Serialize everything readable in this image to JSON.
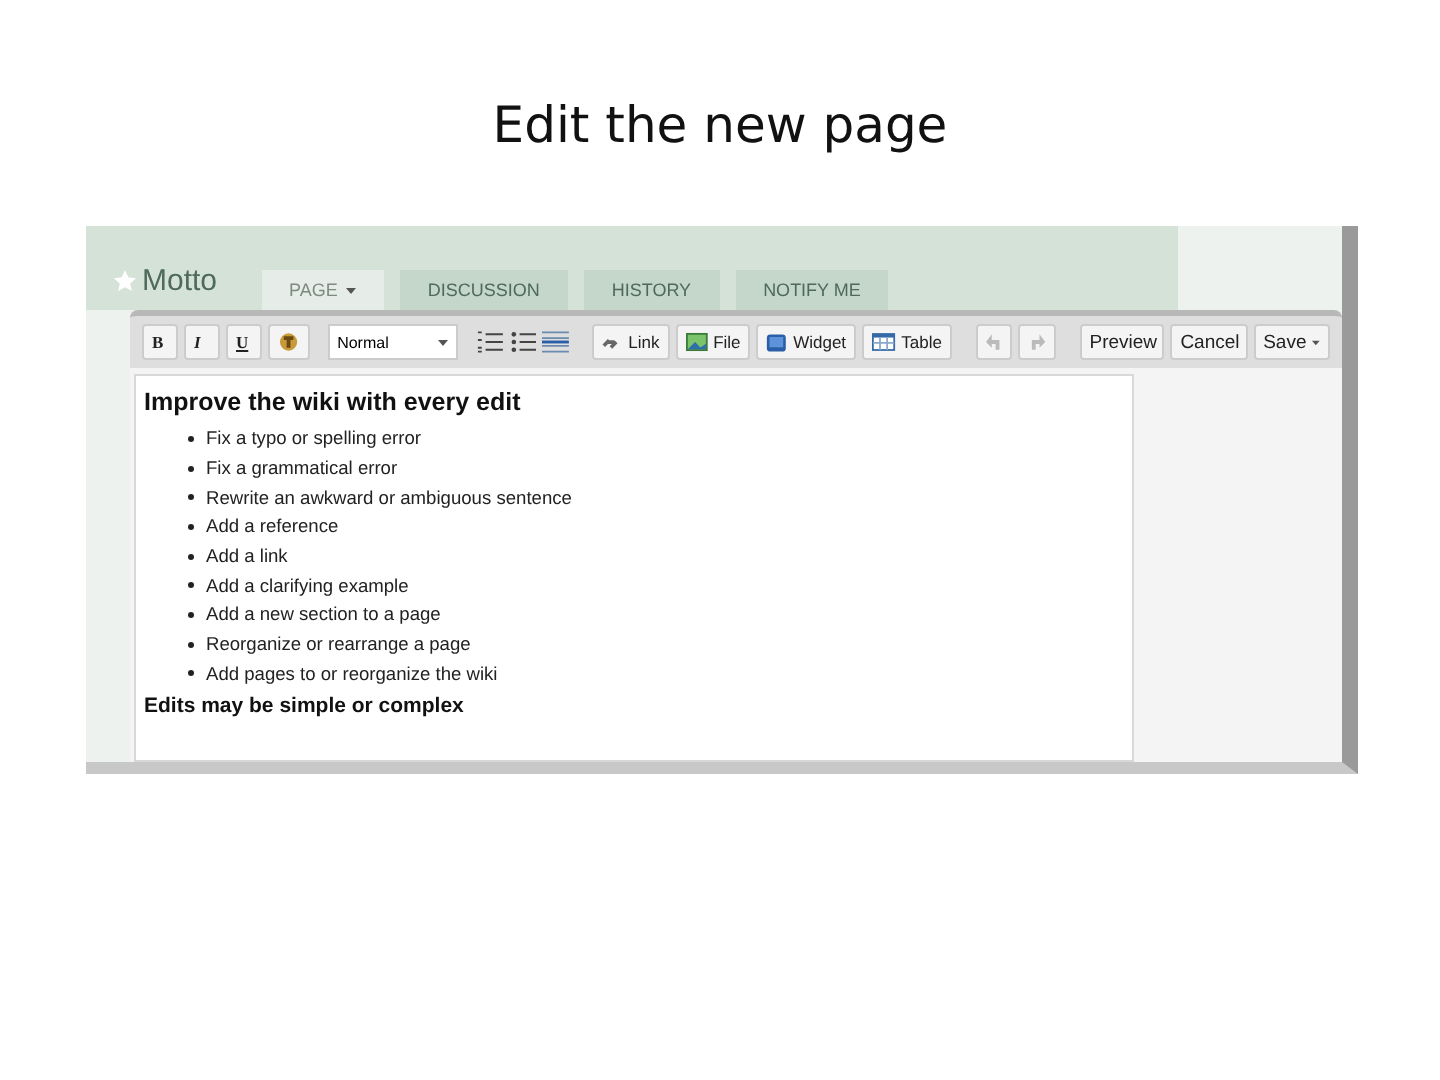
{
  "slide_title": "Edit the new page",
  "site": {
    "logo": "Motto"
  },
  "tabs": [
    {
      "label": "PAGE",
      "selected": true,
      "dropdown": true
    },
    {
      "label": "DISCUSSION",
      "selected": false,
      "dropdown": false
    },
    {
      "label": "HISTORY",
      "selected": false,
      "dropdown": false
    },
    {
      "label": "NOTIFY ME",
      "selected": false,
      "dropdown": false
    }
  ],
  "toolbar": {
    "format_buttons": [
      {
        "kind": "bold",
        "label": "B"
      },
      {
        "kind": "italic",
        "label": "I"
      },
      {
        "kind": "underline",
        "label": "U"
      },
      {
        "kind": "color"
      }
    ],
    "style_select": "Normal",
    "insert_buttons": [
      {
        "kind": "link",
        "label": "Link"
      },
      {
        "kind": "file",
        "label": "File"
      },
      {
        "kind": "widget",
        "label": "Widget"
      },
      {
        "kind": "table",
        "label": "Table"
      }
    ],
    "history_buttons": [
      {
        "kind": "undo",
        "disabled": true
      },
      {
        "kind": "redo",
        "disabled": true
      }
    ],
    "actions": [
      {
        "label": "Preview",
        "dropdown": false
      },
      {
        "label": "Cancel",
        "dropdown": false
      },
      {
        "label": "Save",
        "dropdown": true
      }
    ]
  },
  "editor": {
    "heading": "Improve the wiki with every edit",
    "items": [
      "Fix a typo or spelling error",
      "Fix a grammatical error",
      "Rewrite an awkward or ambiguous sentence",
      "Add a reference",
      "Add a link",
      "Add a clarifying example",
      "Add a new section to a page",
      "Reorganize or rearrange a page",
      "Add pages to or reorganize the wiki"
    ],
    "subheading": "Edits may be simple or complex"
  }
}
